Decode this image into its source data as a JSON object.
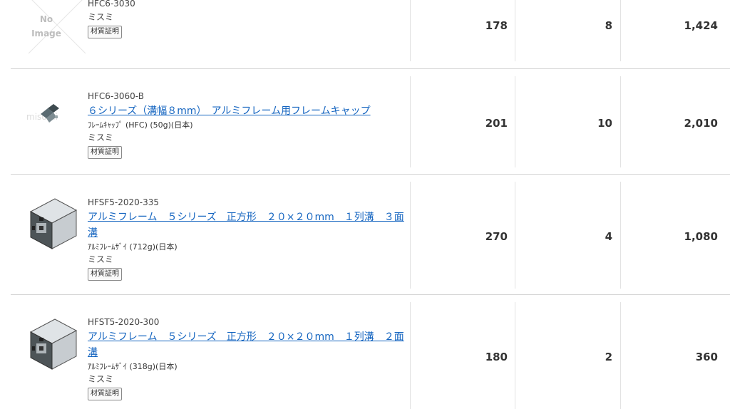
{
  "rows": [
    {
      "code": "HFC6-3030",
      "name": "",
      "spec": "",
      "maker": "ミスミ",
      "cert": "材質証明",
      "image": "no-image",
      "no_image_text": "No\nImage",
      "c1": "178",
      "c2": "8",
      "c3": "1,424"
    },
    {
      "code": "HFC6-3060-B",
      "name": "６シリーズ（溝幅８mm）　アルミフレーム用フレームキャップ",
      "spec": "ﾌﾚｰﾑｷｬｯﾌﾟ (HFC) (50g)(日本)",
      "maker": "ミスミ",
      "cert": "材質証明",
      "image": "frame-cap",
      "c1": "201",
      "c2": "10",
      "c3": "2,010"
    },
    {
      "code": "HFSF5-2020-335",
      "name": "アルミフレーム　５シリーズ　正方形　２０×２０mm　１列溝　３面溝",
      "spec": "ｱﾙﾐﾌﾚｰﾑｻﾞｲ (712g)(日本)",
      "maker": "ミスミ",
      "cert": "材質証明",
      "image": "aluminum-profile",
      "c1": "270",
      "c2": "4",
      "c3": "1,080"
    },
    {
      "code": "HFST5-2020-300",
      "name": "アルミフレーム　５シリーズ　正方形　２０×２０mm　１列溝　２面溝",
      "spec": "ｱﾙﾐﾌﾚｰﾑｻﾞｲ (318g)(日本)",
      "maker": "ミスミ",
      "cert": "材質証明",
      "image": "aluminum-profile",
      "c1": "180",
      "c2": "2",
      "c3": "360"
    }
  ]
}
